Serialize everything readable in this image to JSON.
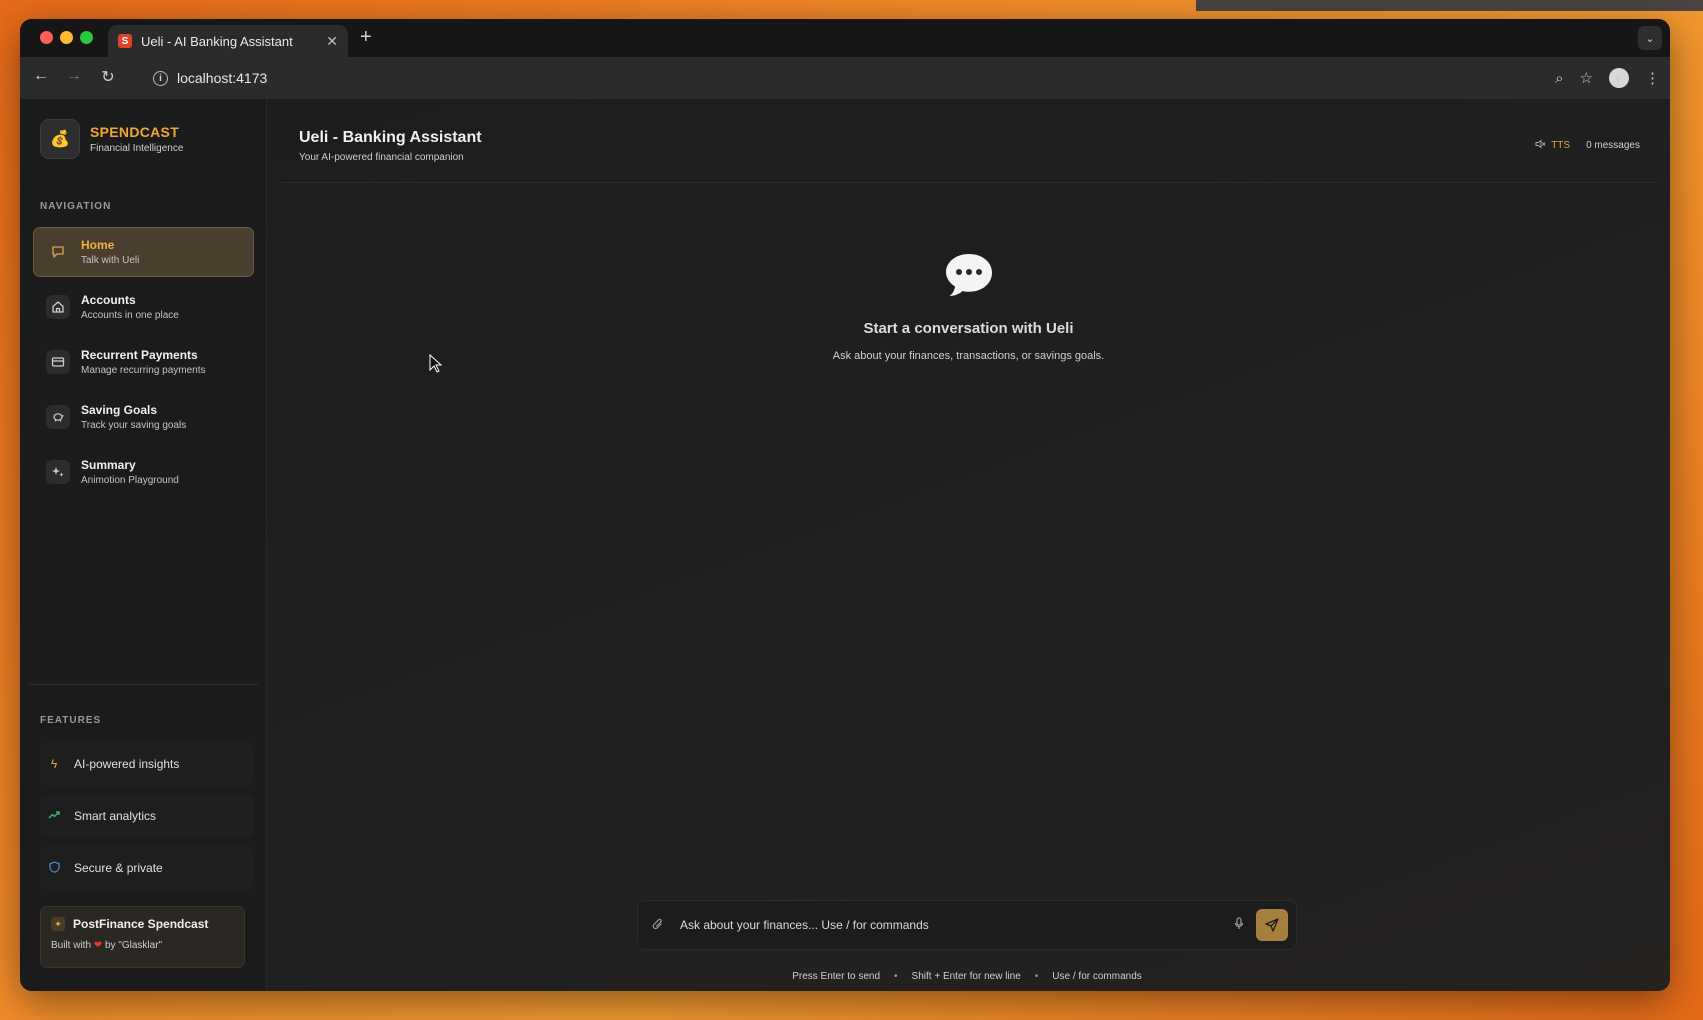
{
  "browser": {
    "tab_title": "Ueli - AI Banking Assistant",
    "tab_favicon": "S",
    "url": "localhost:4173",
    "new_tab_label": "+",
    "tab_close_label": "✕"
  },
  "sidebar": {
    "brand_name": "SPENDCAST",
    "brand_tagline": "Financial Intelligence",
    "nav_label": "NAVIGATION",
    "nav_items": [
      {
        "title": "Home",
        "subtitle": "Talk with Ueli",
        "icon": "chat-icon",
        "active": true
      },
      {
        "title": "Accounts",
        "subtitle": "Accounts in one place",
        "icon": "home-icon",
        "active": false
      },
      {
        "title": "Recurrent Payments",
        "subtitle": "Manage recurring payments",
        "icon": "card-icon",
        "active": false
      },
      {
        "title": "Saving Goals",
        "subtitle": "Track your saving goals",
        "icon": "piggy-bank-icon",
        "active": false
      },
      {
        "title": "Summary",
        "subtitle": "Animotion Playground",
        "icon": "sparkles-icon",
        "active": false
      }
    ],
    "features_label": "FEATURES",
    "features": [
      {
        "label": "AI-powered insights",
        "icon": "lightning-icon",
        "color": "#e0a83a"
      },
      {
        "label": "Smart analytics",
        "icon": "trend-up-icon",
        "color": "#3ec07a"
      },
      {
        "label": "Secure & private",
        "icon": "shield-icon",
        "color": "#4a8fe0"
      }
    ],
    "footer": {
      "title": "PostFinance Spendcast",
      "built_prefix": "Built with",
      "built_suffix": "by \"Glasklar\""
    }
  },
  "main": {
    "title": "Ueli - Banking Assistant",
    "subtitle": "Your AI-powered financial companion",
    "tts_label": "TTS",
    "message_count": "0 messages",
    "empty_title": "Start a conversation with Ueli",
    "empty_subtitle": "Ask about your finances, transactions, or savings goals.",
    "composer_placeholder": "Ask about your finances... Use / for commands",
    "hints": [
      "Press Enter to send",
      "Shift + Enter for new line",
      "Use / for commands"
    ]
  },
  "colors": {
    "accent": "#f0a830",
    "active_nav_bg": "#4a3f2e",
    "send_button": "#a57f3c"
  }
}
